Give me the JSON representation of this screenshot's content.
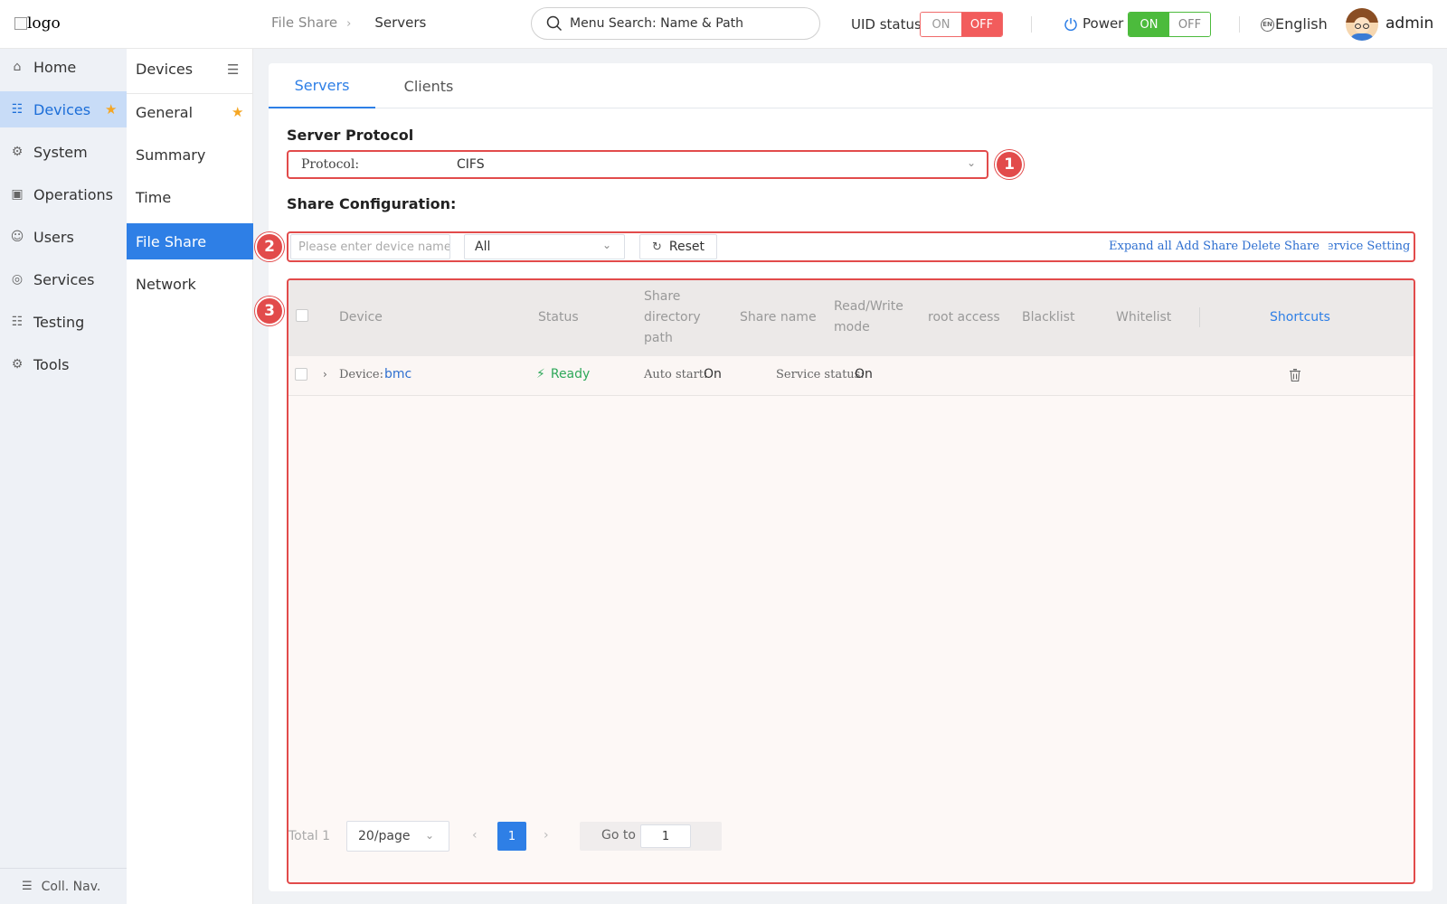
{
  "header": {
    "logo_alt": "logo",
    "breadcrumb": {
      "parent": "File Share",
      "current": "Servers"
    },
    "search": {
      "placeholder": "Menu Search: Name & Path"
    },
    "uid_status": {
      "label": "UID status",
      "on": "ON",
      "off": "OFF",
      "selected": "OFF"
    },
    "power": {
      "label": "Power",
      "on": "ON",
      "off": "OFF",
      "selected": "ON"
    },
    "language": {
      "icon_text": "EN",
      "label": "English"
    },
    "user": {
      "name": "admin"
    }
  },
  "sidebar": {
    "items": [
      {
        "label": "Home",
        "icon": "home-icon"
      },
      {
        "label": "Devices",
        "icon": "devices-icon",
        "active": true,
        "starred": true
      },
      {
        "label": "System",
        "icon": "system-icon"
      },
      {
        "label": "Operations",
        "icon": "operations-icon"
      },
      {
        "label": "Users",
        "icon": "users-icon"
      },
      {
        "label": "Services",
        "icon": "services-icon"
      },
      {
        "label": "Testing",
        "icon": "testing-icon"
      },
      {
        "label": "Tools",
        "icon": "tools-icon"
      }
    ],
    "collapse_label": "Coll. Nav."
  },
  "subnav": {
    "title": "Devices",
    "items": [
      {
        "label": "General",
        "starred": true
      },
      {
        "label": "Summary"
      },
      {
        "label": "Time"
      },
      {
        "label": "File Share",
        "active": true
      },
      {
        "label": "Network"
      }
    ]
  },
  "main": {
    "tabs": [
      {
        "label": "Servers",
        "active": true
      },
      {
        "label": "Clients"
      }
    ],
    "server_protocol": {
      "title": "Server Protocol",
      "label": "Protocol:",
      "value": "CIFS"
    },
    "share_config": {
      "title": "Share Configuration:",
      "device_input_placeholder": "Please enter device name",
      "filter_value": "All",
      "reset_label": "Reset",
      "actions": [
        "Expand all",
        "Add Share",
        "Delete Share",
        "Service Setting"
      ]
    },
    "table": {
      "columns": [
        "Device",
        "Status",
        "Share directory path",
        "Share name",
        "Read/Write mode",
        "root access",
        "Blacklist",
        "Whitelist",
        "Shortcuts"
      ],
      "rows": [
        {
          "device_label": "Device:",
          "device_value": "bmc",
          "status": "Ready",
          "auto_start_label": "Auto start:",
          "auto_start_value": "On",
          "service_status_label": "Service status:",
          "service_status_value": "On"
        }
      ]
    },
    "pagination": {
      "total": "Total 1",
      "page_size": "20/page",
      "current_page": "1",
      "goto_label": "Go to",
      "goto_value": "1"
    },
    "annotations": [
      "1",
      "2",
      "3"
    ]
  },
  "colors": {
    "accent": "#2e7fe6",
    "annotation_red": "#e24b4b",
    "uid_off": "#f25c5c",
    "power_on": "#4cbb3c",
    "ready_green": "#2fa85a",
    "star": "#f5a623"
  }
}
